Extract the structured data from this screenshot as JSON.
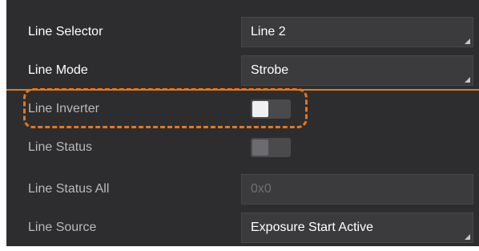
{
  "rows": [
    {
      "label": "Line Selector",
      "value": "Line 2"
    },
    {
      "label": "Line Mode",
      "value": "Strobe"
    },
    {
      "label": "Line Inverter",
      "state": "off"
    },
    {
      "label": "Line Status",
      "state": "off"
    },
    {
      "label": "Line Status All",
      "value": "0x0"
    },
    {
      "label": "Line Source",
      "value": "Exposure Start Active"
    }
  ],
  "colors": {
    "panel_bg": "#2d2d2f",
    "field_bg": "#3b3b3e",
    "accent_orange": "#e8751a",
    "label_active": "#ffffff",
    "label_dim": "#b9b9bb"
  },
  "icons": {
    "dropdown": "dropdown-corner-icon"
  }
}
